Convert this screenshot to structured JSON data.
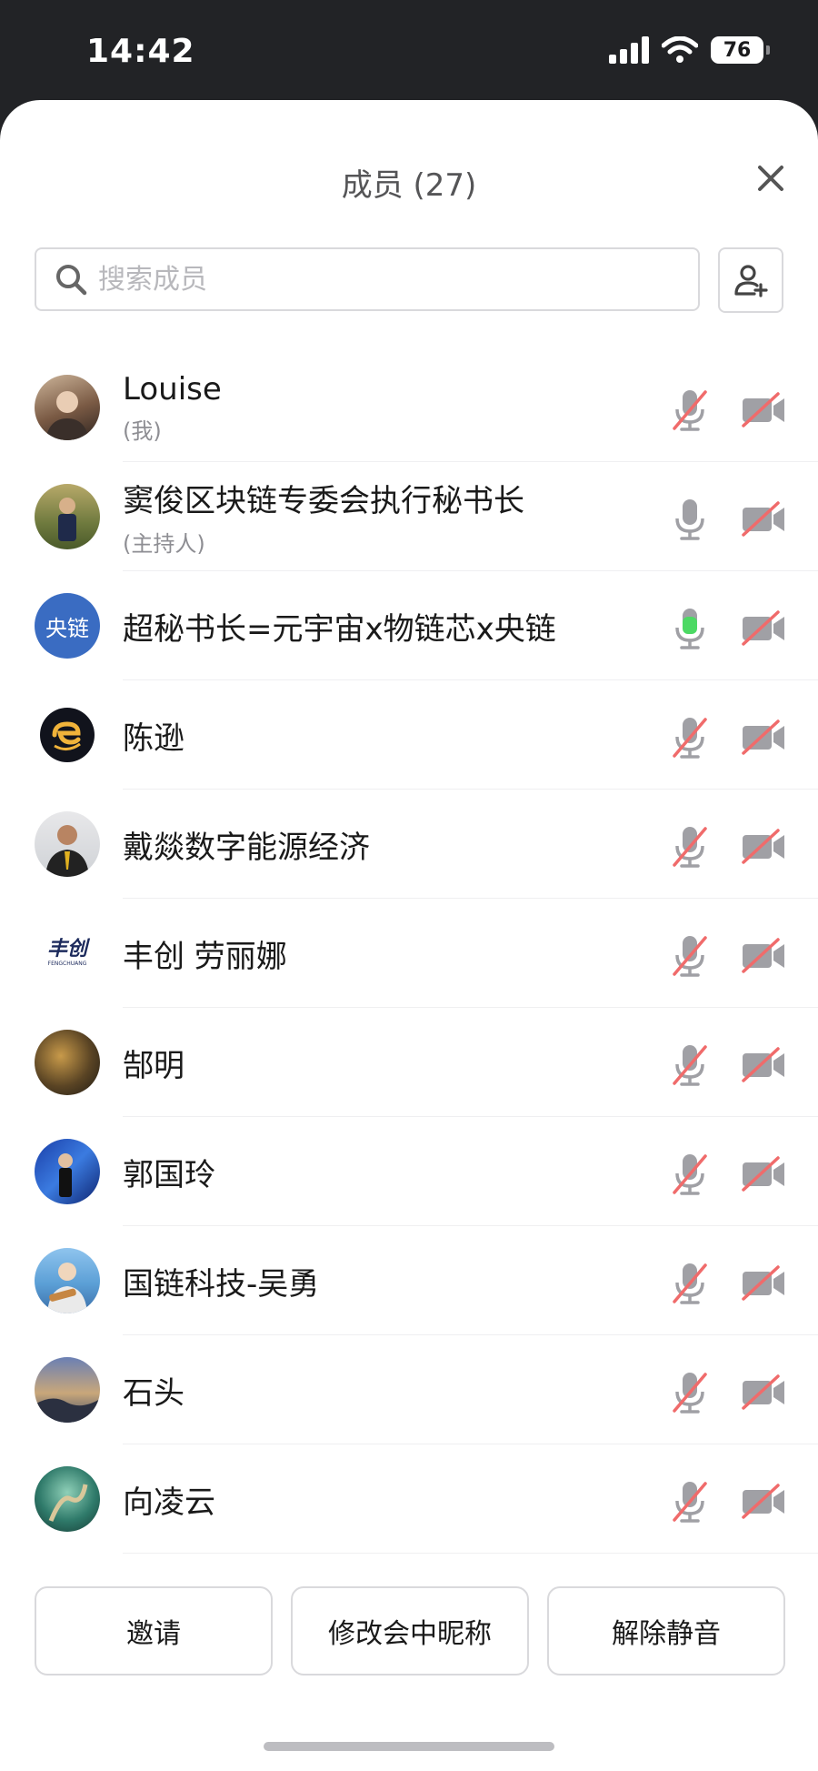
{
  "status_bar": {
    "time": "14:42",
    "battery": "76",
    "icons": [
      "signal-icon",
      "wifi-icon",
      "battery-icon"
    ]
  },
  "panel": {
    "title": "成员 (27)",
    "close_icon": "close-icon",
    "search_placeholder": "搜索成员",
    "add_member_icon": "add-member-icon"
  },
  "members": [
    {
      "name": "Louise",
      "role": "(我)",
      "avatar": "photo",
      "mic": "muted",
      "camera": "off"
    },
    {
      "name": "窦俊区块链专委会执行秘书长",
      "role": "(主持人)",
      "avatar": "photo",
      "mic": "on",
      "camera": "off"
    },
    {
      "name": "超秘书长=元宇宙x物链芯x央链",
      "role": "",
      "avatar": "text",
      "avatar_text": "央链",
      "mic": "active",
      "camera": "off"
    },
    {
      "name": "陈逊",
      "role": "",
      "avatar": "logo",
      "mic": "muted",
      "camera": "off"
    },
    {
      "name": "戴燚数字能源经济",
      "role": "",
      "avatar": "photo",
      "mic": "muted",
      "camera": "off"
    },
    {
      "name": "丰创 劳丽娜",
      "role": "",
      "avatar": "logo",
      "avatar_text": "丰创",
      "avatar_subtext": "FENGCHUANG",
      "mic": "muted",
      "camera": "off"
    },
    {
      "name": "郜明",
      "role": "",
      "avatar": "photo",
      "mic": "muted",
      "camera": "off"
    },
    {
      "name": "郭国玲",
      "role": "",
      "avatar": "photo",
      "mic": "muted",
      "camera": "off"
    },
    {
      "name": "国链科技-吴勇",
      "role": "",
      "avatar": "photo",
      "mic": "muted",
      "camera": "off"
    },
    {
      "name": "石头",
      "role": "",
      "avatar": "photo",
      "mic": "muted",
      "camera": "off"
    },
    {
      "name": "向凌云",
      "role": "",
      "avatar": "photo",
      "mic": "muted",
      "camera": "off"
    }
  ],
  "actions": {
    "invite": "邀请",
    "rename": "修改会中昵称",
    "unmute": "解除静音"
  },
  "colors": {
    "active_mic": "#4cd964",
    "muted_slash": "#f06b6b",
    "icon_gray": "#a0a0a5",
    "avatar_blue": "#3a6cc2"
  }
}
